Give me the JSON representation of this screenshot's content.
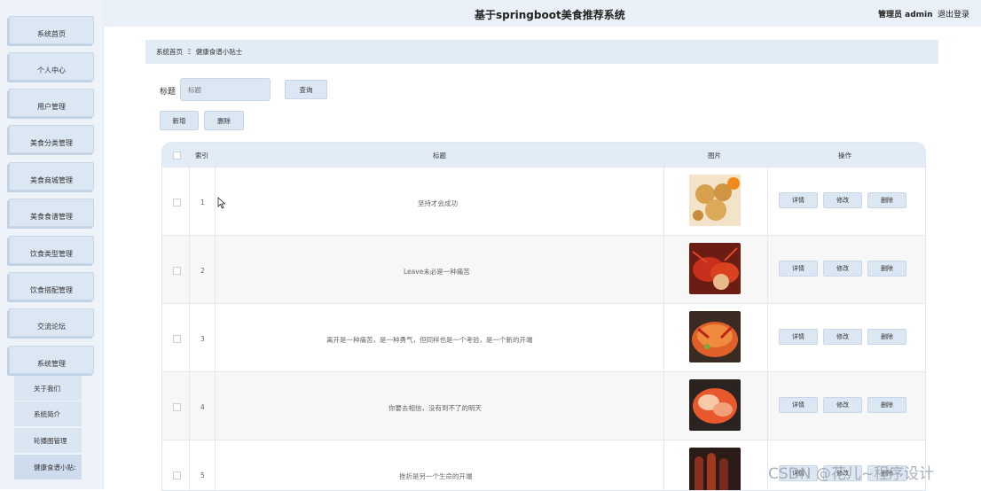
{
  "header": {
    "title": "基于springboot美食推荐系统",
    "user": "管理员 admin",
    "logout": "退出登录"
  },
  "sidebar": {
    "items": [
      {
        "label": "系统首页"
      },
      {
        "label": "个人中心"
      },
      {
        "label": "用户管理"
      },
      {
        "label": "美食分类管理"
      },
      {
        "label": "美食商城管理"
      },
      {
        "label": "美食食谱管理"
      },
      {
        "label": "饮食类型管理"
      },
      {
        "label": "饮食搭配管理"
      },
      {
        "label": "交流论坛"
      },
      {
        "label": "系统管理"
      }
    ],
    "subitems": [
      {
        "label": "关于我们"
      },
      {
        "label": "系统简介"
      },
      {
        "label": "轮播图管理"
      },
      {
        "label": "健康食谱小贴:"
      }
    ]
  },
  "breadcrumb": {
    "home": "系统首页",
    "separator": "Ξ",
    "current": "健康食谱小贴士"
  },
  "search": {
    "label": "标题",
    "placeholder": "标题",
    "button": "查询"
  },
  "toolbar": {
    "add": "新增",
    "delete": "删除"
  },
  "table": {
    "headers": {
      "index": "索引",
      "title": "标题",
      "image": "图片",
      "actions": "操作"
    },
    "actions": {
      "detail": "详情",
      "edit": "修改",
      "delete": "删除"
    },
    "rows": [
      {
        "index": "1",
        "title": "坚持才会成功"
      },
      {
        "index": "2",
        "title": "Leave未必是一种痛苦"
      },
      {
        "index": "3",
        "title": "离开是一种痛苦，是一种勇气，但同样也是一个考验，是一个新的开端"
      },
      {
        "index": "4",
        "title": "你要去相信，没有到不了的明天"
      },
      {
        "index": "5",
        "title": "挫折是另一个生命的开端"
      }
    ]
  },
  "watermark": "CSDN @花儿~程序设计",
  "colors": {
    "accent": "#dce7f4",
    "header_bg": "#e9f0f8",
    "sidebar_bg": "#eef3fa"
  }
}
